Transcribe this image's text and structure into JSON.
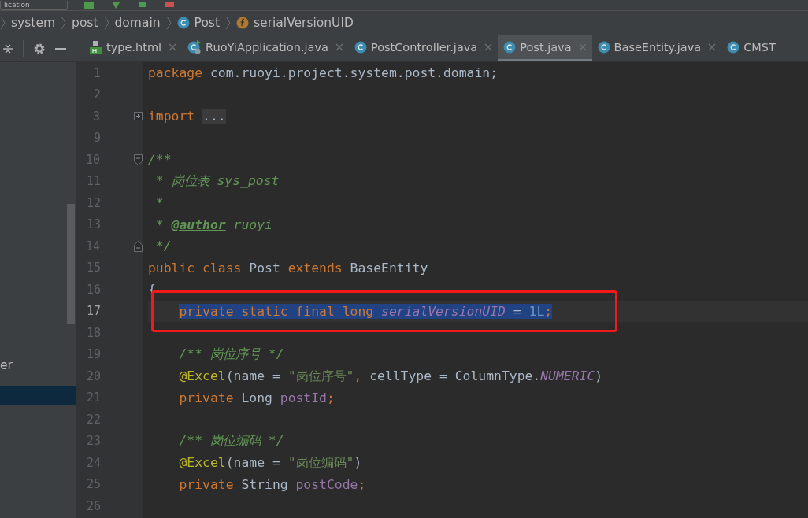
{
  "toolbar": {
    "run_config": "lication"
  },
  "breadcrumbs": [
    {
      "label": "system",
      "kind": "package"
    },
    {
      "label": "post",
      "kind": "package"
    },
    {
      "label": "domain",
      "kind": "package"
    },
    {
      "label": "Post",
      "kind": "class"
    },
    {
      "label": "serialVersionUID",
      "kind": "field"
    }
  ],
  "tabs": [
    {
      "label": "type.html",
      "kind": "html",
      "selected": false,
      "closable": true
    },
    {
      "label": "RuoYiApplication.java",
      "kind": "runnable",
      "selected": false,
      "closable": true
    },
    {
      "label": "PostController.java",
      "kind": "class",
      "selected": false,
      "closable": true
    },
    {
      "label": "Post.java",
      "kind": "class",
      "selected": true,
      "closable": true
    },
    {
      "label": "BaseEntity.java",
      "kind": "class",
      "selected": false,
      "closable": true
    },
    {
      "label": "CMST",
      "kind": "class",
      "selected": false,
      "closable": false
    }
  ],
  "project_tree": [
    {
      "label": "er",
      "selected": false
    },
    {
      "selected": true
    }
  ],
  "editor": {
    "lines": [
      {
        "number": "1",
        "kind": "code",
        "selected": false,
        "outlined": false,
        "tokens": [
          {
            "kind": "keyword",
            "text": "package"
          },
          {
            "kind": "plain",
            "text": " com.ruoyi.project.system.post.domain;"
          }
        ]
      },
      {
        "number": "2",
        "kind": "code",
        "selected": false,
        "outlined": false
      },
      {
        "number": "3",
        "kind": "folded",
        "selected": false,
        "outlined": false,
        "tokens": [
          {
            "kind": "keyword",
            "text": "import "
          },
          {
            "kind": "folded",
            "text": "..."
          }
        ]
      },
      {
        "number": "9",
        "kind": "code",
        "selected": false,
        "outlined": false
      },
      {
        "number": "10",
        "kind": "fold-start",
        "selected": false,
        "outlined": false,
        "tokens": [
          {
            "kind": "doc",
            "text": "/**"
          }
        ]
      },
      {
        "number": "11",
        "kind": "code",
        "selected": false,
        "outlined": false,
        "tokens": [
          {
            "kind": "doc",
            "text": " * 岗位表 sys_post"
          }
        ]
      },
      {
        "number": "12",
        "kind": "code",
        "selected": false,
        "outlined": false,
        "tokens": [
          {
            "kind": "doc",
            "text": " *"
          }
        ]
      },
      {
        "number": "13",
        "kind": "code",
        "selected": false,
        "outlined": false,
        "tokens": [
          {
            "kind": "doc",
            "text": " * "
          },
          {
            "kind": "doctag",
            "text": "@author"
          },
          {
            "kind": "doc",
            "text": " ruoyi"
          }
        ]
      },
      {
        "number": "14",
        "kind": "fold-end",
        "selected": false,
        "outlined": false,
        "tokens": [
          {
            "kind": "doc",
            "text": " */"
          }
        ]
      },
      {
        "number": "15",
        "kind": "code",
        "selected": false,
        "outlined": false,
        "tokens": [
          {
            "kind": "keyword",
            "text": "public class "
          },
          {
            "kind": "plain",
            "text": "Post "
          },
          {
            "kind": "keyword",
            "text": "extends "
          },
          {
            "kind": "plain",
            "text": "BaseEntity"
          }
        ]
      },
      {
        "number": "16",
        "kind": "code",
        "selected": false,
        "outlined": false,
        "tokens": [
          {
            "kind": "plain",
            "text": "{"
          }
        ]
      },
      {
        "number": "17",
        "kind": "code",
        "selected": true,
        "outlined": true,
        "indented": true,
        "tokens": [
          {
            "kind": "keyword",
            "text": "private static final long "
          },
          {
            "kind": "static",
            "text": "serialVersionUID"
          },
          {
            "kind": "plain",
            "text": " = "
          },
          {
            "kind": "number",
            "text": "1L"
          },
          {
            "kind": "keyword",
            "text": ";"
          }
        ]
      },
      {
        "number": "18",
        "kind": "code",
        "selected": false,
        "outlined": false
      },
      {
        "number": "19",
        "kind": "code",
        "selected": false,
        "outlined": false,
        "indented": true,
        "tokens": [
          {
            "kind": "doc",
            "text": "/** 岗位序号 */"
          }
        ]
      },
      {
        "number": "20",
        "kind": "code",
        "selected": false,
        "outlined": false,
        "indented": true,
        "tokens": [
          {
            "kind": "annotation",
            "text": "@Excel"
          },
          {
            "kind": "plain",
            "text": "(name = "
          },
          {
            "kind": "string",
            "text": "\"岗位序号\""
          },
          {
            "kind": "keyword",
            "text": ", "
          },
          {
            "kind": "plain",
            "text": "cellType = ColumnType."
          },
          {
            "kind": "static",
            "text": "NUMERIC"
          },
          {
            "kind": "plain",
            "text": ")"
          }
        ]
      },
      {
        "number": "21",
        "kind": "code",
        "selected": false,
        "outlined": false,
        "indented": true,
        "tokens": [
          {
            "kind": "keyword",
            "text": "private "
          },
          {
            "kind": "plain",
            "text": "Long "
          },
          {
            "kind": "field",
            "text": "postId"
          },
          {
            "kind": "keyword",
            "text": ";"
          }
        ]
      },
      {
        "number": "22",
        "kind": "code",
        "selected": false,
        "outlined": false
      },
      {
        "number": "23",
        "kind": "code",
        "selected": false,
        "outlined": false,
        "indented": true,
        "tokens": [
          {
            "kind": "doc",
            "text": "/** 岗位编码 */"
          }
        ]
      },
      {
        "number": "24",
        "kind": "code",
        "selected": false,
        "outlined": false,
        "indented": true,
        "tokens": [
          {
            "kind": "annotation",
            "text": "@Excel"
          },
          {
            "kind": "plain",
            "text": "(name = "
          },
          {
            "kind": "string",
            "text": "\"岗位编码\""
          },
          {
            "kind": "plain",
            "text": ")"
          }
        ]
      },
      {
        "number": "25",
        "kind": "code",
        "selected": false,
        "outlined": false,
        "indented": true,
        "tokens": [
          {
            "kind": "keyword",
            "text": "private "
          },
          {
            "kind": "plain",
            "text": "String "
          },
          {
            "kind": "field",
            "text": "postCode"
          },
          {
            "kind": "keyword",
            "text": ";"
          }
        ]
      },
      {
        "number": "26",
        "kind": "code",
        "selected": false,
        "outlined": false
      }
    ]
  }
}
